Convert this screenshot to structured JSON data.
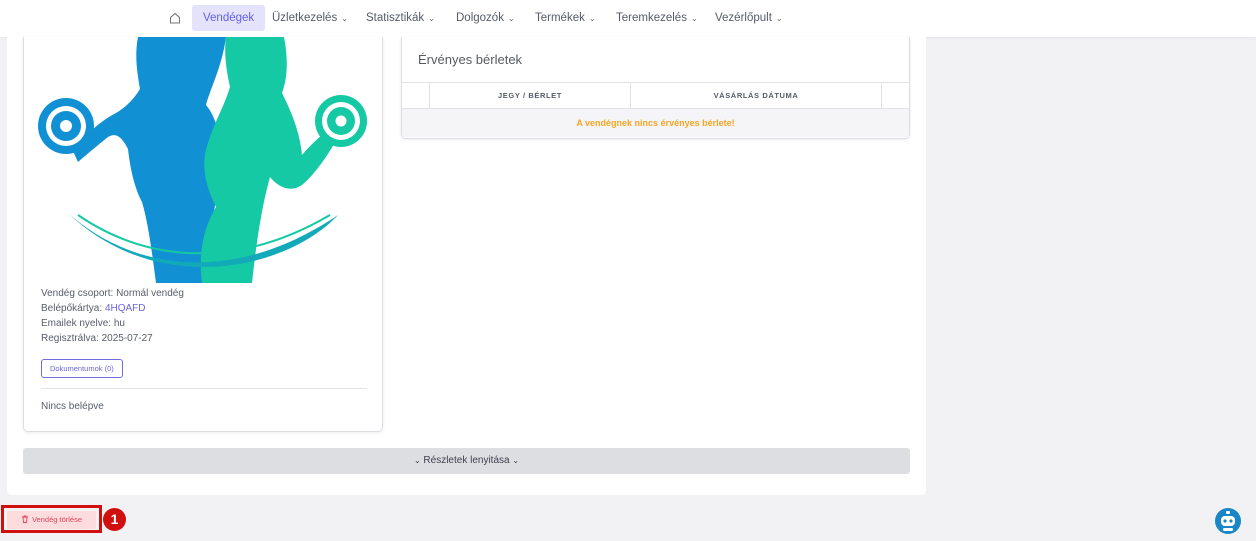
{
  "nav": {
    "home_icon": "home-icon",
    "items": [
      {
        "label": "Vendégek",
        "active": true
      },
      {
        "label": "Üzletkezelés"
      },
      {
        "label": "Statisztikák"
      },
      {
        "label": "Dolgozók"
      },
      {
        "label": "Termékek"
      },
      {
        "label": "Teremkezelés"
      },
      {
        "label": "Vezérlőpult"
      }
    ],
    "chevron": "⌄"
  },
  "profile": {
    "group_label": "Vendég csoport:",
    "group_value": "Normál vendég",
    "card_label": "Belépőkártya:",
    "card_value": "4HQAFD",
    "email_lang_label": "Emailek nyelve:",
    "email_lang_value": "hu",
    "registered_label": "Regisztrálva:",
    "registered_value": "2025-07-27",
    "documents_button": "Dokumentumok (0)",
    "entry_status": "Nincs belépve"
  },
  "passes": {
    "title": "Érvényes bérletek",
    "columns": [
      "JEGY / BÉRLET",
      "VÁSÁRLÁS DÁTUMA"
    ],
    "empty_message": "A vendégnek nincs érvényes bérlete!"
  },
  "details_button": "Részletek lenyitása",
  "delete_button": "Vendég törlése",
  "annotation_marker": "1",
  "colors": {
    "accent": "#6661e0",
    "warning": "#f5a623",
    "danger": "#e0455b",
    "highlight": "#d00f0f",
    "fitness_blue": "#1190d4",
    "fitness_teal": "#15c9a4"
  }
}
